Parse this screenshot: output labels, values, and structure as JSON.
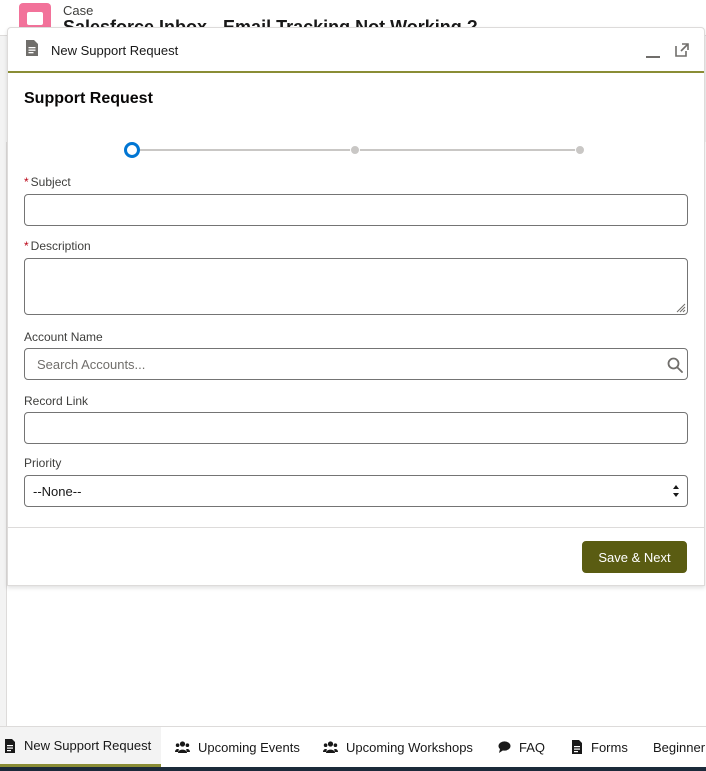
{
  "background": {
    "case_label": "Case",
    "case_title": "Salesforce Inbox - Email Tracking Not Working ?"
  },
  "composer": {
    "title": "New Support Request",
    "icons": {
      "doc": "document-icon",
      "minimize": "minimize-icon",
      "expand": "pop-out-icon"
    }
  },
  "form": {
    "section_title": "Support Request",
    "progress": {
      "total_steps": 3,
      "current_step": 1
    },
    "required_marker": "*",
    "subject": {
      "label": "Subject",
      "value": ""
    },
    "description": {
      "label": "Description",
      "value": ""
    },
    "account": {
      "label": "Account Name",
      "placeholder": "Search Accounts...",
      "value": ""
    },
    "record_link": {
      "label": "Record Link",
      "value": ""
    },
    "priority": {
      "label": "Priority",
      "selected": "--None--"
    },
    "save_button": "Save & Next"
  },
  "utility_bar": {
    "items": [
      {
        "label": "New Support Request",
        "icon": "document-icon",
        "active": true
      },
      {
        "label": "Upcoming Events",
        "icon": "people-icon",
        "active": false
      },
      {
        "label": "Upcoming Workshops",
        "icon": "people-icon",
        "active": false
      },
      {
        "label": "FAQ",
        "icon": "chat-icon",
        "active": false
      },
      {
        "label": "Forms",
        "icon": "document-icon",
        "active": false
      },
      {
        "label": "Beginner",
        "icon": "",
        "active": false
      }
    ]
  },
  "colors": {
    "accent_olive": "#8a8d35",
    "button_olive": "#5a5c12",
    "progress_blue": "#0176d3",
    "required_red": "#ba0517"
  }
}
